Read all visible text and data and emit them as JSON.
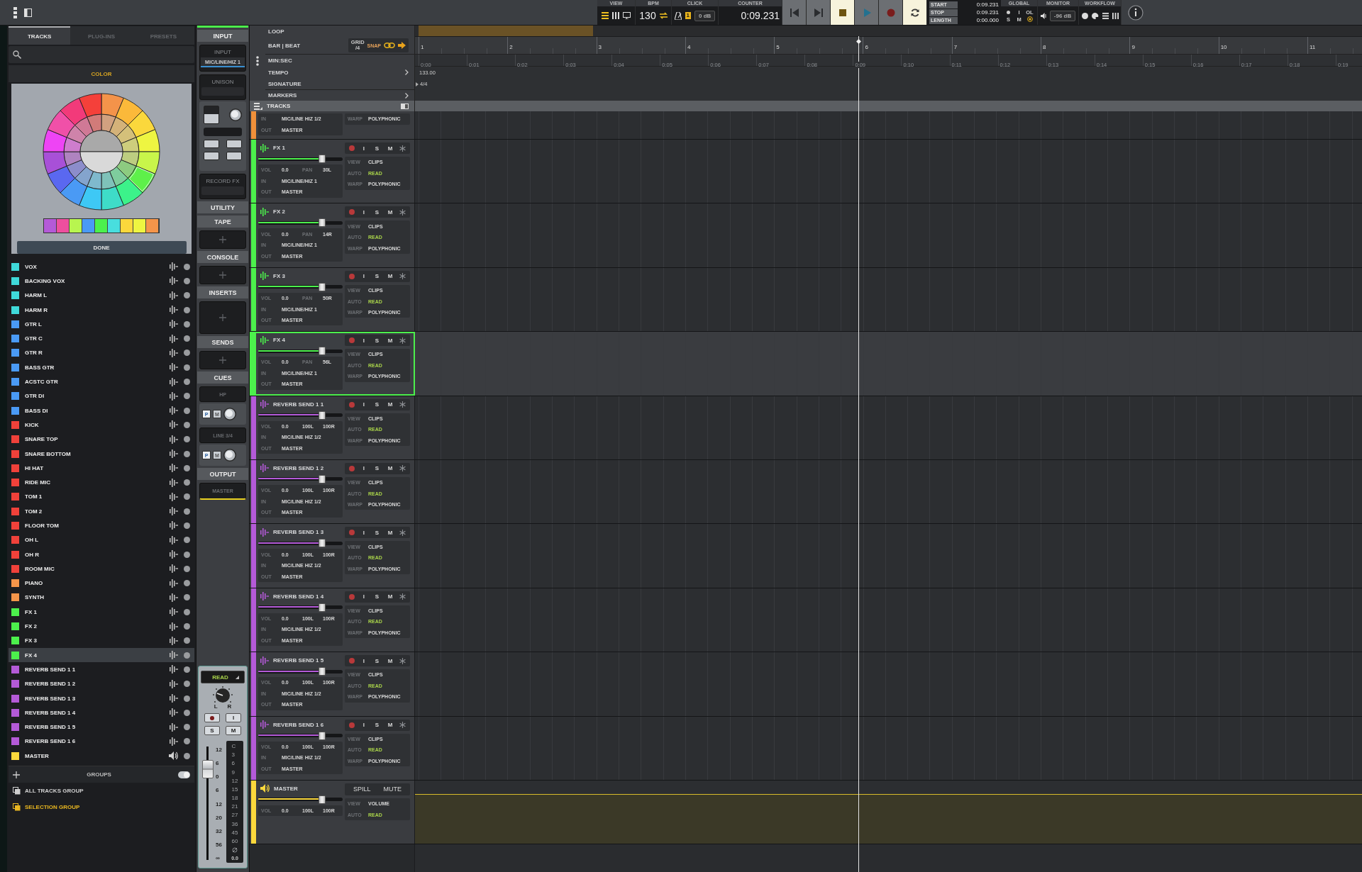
{
  "topbar": {
    "view": {
      "label": "VIEW"
    },
    "bpm": {
      "label": "BPM",
      "value": "130"
    },
    "click": {
      "label": "CLICK",
      "badge": "1",
      "level": "0 dB"
    },
    "counter": {
      "label": "COUNTER",
      "value": "0:09.231"
    },
    "transport": [
      {
        "kind": "prev",
        "on": false
      },
      {
        "kind": "next",
        "on": false
      },
      {
        "kind": "stop",
        "on": true
      },
      {
        "kind": "play",
        "on": false
      },
      {
        "kind": "record",
        "on": false
      },
      {
        "kind": "loop",
        "on": true
      }
    ],
    "positions": [
      {
        "label": "START",
        "value": "0:09.231"
      },
      {
        "label": "STOP",
        "value": "0:09.231"
      },
      {
        "label": "LENGTH",
        "value": "0:00.000"
      }
    ],
    "global": {
      "label": "GLOBAL",
      "items": [
        "I",
        "OL",
        "S",
        "M"
      ]
    },
    "monitor": {
      "label": "MONITOR",
      "value": "-96 dB"
    },
    "workflow": {
      "label": "WORKFLOW"
    }
  },
  "browser": {
    "tabs": [
      {
        "label": "TRACKS",
        "selected": true
      },
      {
        "label": "PLUG-INS",
        "selected": false
      },
      {
        "label": "PRESETS",
        "selected": false
      }
    ],
    "color_header": "COLOR",
    "swatches": [
      {
        "color": "#b45ad8"
      },
      {
        "color": "#ee4f9e"
      },
      {
        "color": "#b8f54f"
      },
      {
        "color": "#4a9af5"
      },
      {
        "color": "#4cf04c"
      },
      {
        "color": "#48dede"
      },
      {
        "color": "#fbd83c"
      },
      {
        "color": "#eef541"
      },
      {
        "color": "#f5954a"
      }
    ],
    "done": "DONE"
  },
  "track_list": [
    {
      "name": "VOX",
      "color": "#3fd9d9",
      "kind": "audio",
      "selected": false
    },
    {
      "name": "BACKING VOX",
      "color": "#3fd9d9",
      "kind": "audio",
      "selected": false
    },
    {
      "name": "HARM L",
      "color": "#3fd9d9",
      "kind": "audio",
      "selected": false
    },
    {
      "name": "HARM R",
      "color": "#3fd9d9",
      "kind": "audio",
      "selected": false
    },
    {
      "name": "GTR L",
      "color": "#4a9af5",
      "kind": "audio",
      "selected": false
    },
    {
      "name": "GTR C",
      "color": "#4a9af5",
      "kind": "audio",
      "selected": false
    },
    {
      "name": "GTR R",
      "color": "#4a9af5",
      "kind": "audio",
      "selected": false
    },
    {
      "name": "BASS GTR",
      "color": "#4a9af5",
      "kind": "audio",
      "selected": false
    },
    {
      "name": "ACSTC GTR",
      "color": "#4a9af5",
      "kind": "audio",
      "selected": false
    },
    {
      "name": "GTR DI",
      "color": "#4a9af5",
      "kind": "audio",
      "selected": false
    },
    {
      "name": "BASS DI",
      "color": "#4a9af5",
      "kind": "audio",
      "selected": false
    },
    {
      "name": "KICK",
      "color": "#f0413a",
      "kind": "audio",
      "selected": false
    },
    {
      "name": "SNARE TOP",
      "color": "#f0413a",
      "kind": "audio",
      "selected": false
    },
    {
      "name": "SNARE BOTTOM",
      "color": "#f0413a",
      "kind": "audio",
      "selected": false
    },
    {
      "name": "HI HAT",
      "color": "#f0413a",
      "kind": "audio",
      "selected": false
    },
    {
      "name": "RIDE MIC",
      "color": "#f0413a",
      "kind": "audio",
      "selected": false
    },
    {
      "name": "TOM 1",
      "color": "#f0413a",
      "kind": "audio",
      "selected": false
    },
    {
      "name": "TOM 2",
      "color": "#f0413a",
      "kind": "audio",
      "selected": false
    },
    {
      "name": "FLOOR TOM",
      "color": "#f0413a",
      "kind": "audio",
      "selected": false
    },
    {
      "name": "OH L",
      "color": "#f0413a",
      "kind": "audio",
      "selected": false
    },
    {
      "name": "OH R",
      "color": "#f0413a",
      "kind": "audio",
      "selected": false
    },
    {
      "name": "ROOM MIC",
      "color": "#f0413a",
      "kind": "audio",
      "selected": false
    },
    {
      "name": "PIANO",
      "color": "#f5954a",
      "kind": "audio",
      "selected": false
    },
    {
      "name": "SYNTH",
      "color": "#f5954a",
      "kind": "audio",
      "selected": false
    },
    {
      "name": "FX 1",
      "color": "#4cf04c",
      "kind": "audio",
      "selected": false
    },
    {
      "name": "FX 2",
      "color": "#4cf04c",
      "kind": "audio",
      "selected": false
    },
    {
      "name": "FX 3",
      "color": "#4cf04c",
      "kind": "audio",
      "selected": false
    },
    {
      "name": "FX 4",
      "color": "#4cf04c",
      "kind": "audio",
      "selected": true
    },
    {
      "name": "REVERB SEND 1 1",
      "color": "#b45ad8",
      "kind": "audio",
      "selected": false
    },
    {
      "name": "REVERB SEND 1 2",
      "color": "#b45ad8",
      "kind": "audio",
      "selected": false
    },
    {
      "name": "REVERB SEND 1 3",
      "color": "#b45ad8",
      "kind": "audio",
      "selected": false
    },
    {
      "name": "REVERB SEND 1 4",
      "color": "#b45ad8",
      "kind": "audio",
      "selected": false
    },
    {
      "name": "REVERB SEND 1 5",
      "color": "#b45ad8",
      "kind": "audio",
      "selected": false
    },
    {
      "name": "REVERB SEND 1 6",
      "color": "#b45ad8",
      "kind": "audio",
      "selected": false
    },
    {
      "name": "MASTER",
      "color": "#fbd83c",
      "kind": "master",
      "selected": false
    }
  ],
  "groups": {
    "title": "GROUPS",
    "on": true,
    "items": [
      {
        "name": "ALL TRACKS GROUP",
        "selected": false
      },
      {
        "name": "SELECTION GROUP",
        "selected": true
      }
    ]
  },
  "channel": {
    "sections": [
      {
        "kind": "header",
        "text": "INPUT"
      },
      {
        "kind": "input",
        "label": "INPUT",
        "value": "MIC/LINE/HIZ 1"
      },
      {
        "kind": "slot",
        "label": "UNISON"
      },
      {
        "kind": "controls"
      },
      {
        "kind": "slot",
        "label": "RECORD FX"
      },
      {
        "kind": "header",
        "text": "UTILITY"
      },
      {
        "kind": "header",
        "text": "TAPE"
      },
      {
        "kind": "add"
      },
      {
        "kind": "header",
        "text": "CONSOLE"
      },
      {
        "kind": "add"
      },
      {
        "kind": "header",
        "text": "INSERTS"
      },
      {
        "kind": "add_large"
      },
      {
        "kind": "header",
        "text": "SENDS"
      },
      {
        "kind": "add"
      },
      {
        "kind": "header",
        "text": "CUES"
      },
      {
        "kind": "cue",
        "label": "HP",
        "buttons": [
          "P",
          "M"
        ]
      },
      {
        "kind": "cue",
        "label": "LINE 3/4",
        "buttons": [
          "P",
          "M"
        ]
      },
      {
        "kind": "header",
        "text": "OUTPUT"
      },
      {
        "kind": "output",
        "value": "MASTER"
      }
    ],
    "strip": {
      "automation": "READ",
      "pan": [
        "L",
        "R"
      ],
      "buttons": [
        "I",
        "S",
        "M"
      ],
      "level": 0.8,
      "fader_scale": [
        "12",
        "6",
        "0",
        "6",
        "12",
        "20",
        "32",
        "56",
        "∞"
      ],
      "meter_scale": [
        "C",
        "3",
        "6",
        "9",
        "12",
        "15",
        "18",
        "21",
        "27",
        "36",
        "45",
        "60"
      ],
      "readout": "0.0"
    }
  },
  "ruler_menu": {
    "rows": [
      {
        "label": "LOOP",
        "kind": "plain"
      },
      {
        "label": "BAR | BEAT",
        "kind": "grid"
      },
      {
        "label": "MIN:SEC",
        "kind": "plain"
      },
      {
        "label": "TEMPO",
        "kind": "submenu"
      },
      {
        "label": "SIGNATURE",
        "kind": "plain"
      },
      {
        "label": "MARKERS",
        "kind": "submenu"
      }
    ],
    "grid": {
      "label": "GRID",
      "value": "/4",
      "snap": "SNAP"
    },
    "tracks_bar": "TRACKS"
  },
  "ruler": {
    "bars": [
      {
        "label": "1",
        "in_loop": true
      },
      {
        "label": "2",
        "in_loop": true
      },
      {
        "label": "3",
        "in_loop": false
      },
      {
        "label": "4",
        "in_loop": false
      },
      {
        "label": "5",
        "in_loop": false
      },
      {
        "label": "6",
        "in_loop": false
      },
      {
        "label": "7",
        "in_loop": false
      },
      {
        "label": "8",
        "in_loop": false
      },
      {
        "label": "9",
        "in_loop": false
      },
      {
        "label": "10",
        "in_loop": false
      },
      {
        "label": "11",
        "in_loop": false
      }
    ],
    "seconds": [
      {
        "label": "0:00",
        "playhead": false
      },
      {
        "label": "0:01",
        "playhead": false
      },
      {
        "label": "0:02",
        "playhead": false
      },
      {
        "label": "0:03",
        "playhead": false
      },
      {
        "label": "0:04",
        "playhead": false
      },
      {
        "label": "0:05",
        "playhead": false
      },
      {
        "label": "0:06",
        "playhead": false
      },
      {
        "label": "0:07",
        "playhead": false
      },
      {
        "label": "0:08",
        "playhead": false
      },
      {
        "label": "0:09",
        "playhead": true
      },
      {
        "label": "0:10",
        "playhead": false
      },
      {
        "label": "0:11",
        "playhead": false
      },
      {
        "label": "0:12",
        "playhead": false
      },
      {
        "label": "0:13",
        "playhead": false
      },
      {
        "label": "0:14",
        "playhead": false
      },
      {
        "label": "0:15",
        "playhead": false
      },
      {
        "label": "0:16",
        "playhead": false
      },
      {
        "label": "0:17",
        "playhead": false
      },
      {
        "label": "0:18",
        "playhead": false
      },
      {
        "label": "0:19",
        "playhead": false
      }
    ],
    "tempo": "133.00",
    "signature": "4/4"
  },
  "tracks": [
    {
      "kind": "partial",
      "color": "#f0903a",
      "selected": false,
      "io": [
        [
          "IN",
          "MIC/LINE HIZ 1/2"
        ],
        [
          "OUT",
          "MASTER"
        ]
      ],
      "info": [
        {
          "label": "WARP",
          "value": "POLYPHONIC"
        }
      ]
    },
    {
      "kind": "audio",
      "name": "FX 1",
      "color": "#4cf04c",
      "selected": false,
      "level": 0.76,
      "vol": [
        "VOL",
        "0.0"
      ],
      "pan_label": "PAN",
      "pan": [
        "30L"
      ],
      "io": [
        [
          "IN",
          "MIC/LINE/HIZ 1"
        ],
        [
          "OUT",
          "MASTER"
        ]
      ],
      "buttons": [
        "I",
        "S",
        "M"
      ],
      "info": [
        {
          "label": "VIEW",
          "value": "CLIPS"
        },
        {
          "label": "AUTO",
          "value": "READ",
          "kind": "auto"
        },
        {
          "label": "WARP",
          "value": "POLYPHONIC"
        }
      ]
    },
    {
      "kind": "audio",
      "name": "FX 2",
      "color": "#4cf04c",
      "selected": false,
      "level": 0.76,
      "vol": [
        "VOL",
        "0.0"
      ],
      "pan_label": "PAN",
      "pan": [
        "14R"
      ],
      "io": [
        [
          "IN",
          "MIC/LINE/HIZ 1"
        ],
        [
          "OUT",
          "MASTER"
        ]
      ],
      "buttons": [
        "I",
        "S",
        "M"
      ],
      "info": [
        {
          "label": "VIEW",
          "value": "CLIPS"
        },
        {
          "label": "AUTO",
          "value": "READ",
          "kind": "auto"
        },
        {
          "label": "WARP",
          "value": "POLYPHONIC"
        }
      ]
    },
    {
      "kind": "audio",
      "name": "FX 3",
      "color": "#4cf04c",
      "selected": false,
      "level": 0.76,
      "vol": [
        "VOL",
        "0.0"
      ],
      "pan_label": "PAN",
      "pan": [
        "50R"
      ],
      "io": [
        [
          "IN",
          "MIC/LINE/HIZ 1"
        ],
        [
          "OUT",
          "MASTER"
        ]
      ],
      "buttons": [
        "I",
        "S",
        "M"
      ],
      "info": [
        {
          "label": "VIEW",
          "value": "CLIPS"
        },
        {
          "label": "AUTO",
          "value": "READ",
          "kind": "auto"
        },
        {
          "label": "WARP",
          "value": "POLYPHONIC"
        }
      ]
    },
    {
      "kind": "audio",
      "name": "FX 4",
      "color": "#4cf04c",
      "selected": true,
      "level": 0.76,
      "vol": [
        "VOL",
        "0.0"
      ],
      "pan_label": "PAN",
      "pan": [
        "56L"
      ],
      "io": [
        [
          "IN",
          "MIC/LINE/HIZ 1"
        ],
        [
          "OUT",
          "MASTER"
        ]
      ],
      "buttons": [
        "I",
        "S",
        "M"
      ],
      "info": [
        {
          "label": "VIEW",
          "value": "CLIPS"
        },
        {
          "label": "AUTO",
          "value": "READ",
          "kind": "auto"
        },
        {
          "label": "WARP",
          "value": "POLYPHONIC"
        }
      ]
    },
    {
      "kind": "audio",
      "name": "REVERB SEND 1 1",
      "color": "#b45ad8",
      "selected": false,
      "level": 0.76,
      "vol": [
        "VOL",
        "0.0"
      ],
      "pan": [
        "100L",
        "100R"
      ],
      "io": [
        [
          "IN",
          "MIC/LINE HIZ 1/2"
        ],
        [
          "OUT",
          "MASTER"
        ]
      ],
      "buttons": [
        "I",
        "S",
        "M"
      ],
      "info": [
        {
          "label": "VIEW",
          "value": "CLIPS"
        },
        {
          "label": "AUTO",
          "value": "READ",
          "kind": "auto"
        },
        {
          "label": "WARP",
          "value": "POLYPHONIC"
        }
      ]
    },
    {
      "kind": "audio",
      "name": "REVERB SEND 1 2",
      "color": "#b45ad8",
      "selected": false,
      "level": 0.76,
      "vol": [
        "VOL",
        "0.0"
      ],
      "pan": [
        "100L",
        "100R"
      ],
      "io": [
        [
          "IN",
          "MIC/LINE HIZ 1/2"
        ],
        [
          "OUT",
          "MASTER"
        ]
      ],
      "buttons": [
        "I",
        "S",
        "M"
      ],
      "info": [
        {
          "label": "VIEW",
          "value": "CLIPS"
        },
        {
          "label": "AUTO",
          "value": "READ",
          "kind": "auto"
        },
        {
          "label": "WARP",
          "value": "POLYPHONIC"
        }
      ]
    },
    {
      "kind": "audio",
      "name": "REVERB SEND 1 3",
      "color": "#b45ad8",
      "selected": false,
      "level": 0.76,
      "vol": [
        "VOL",
        "0.0"
      ],
      "pan": [
        "100L",
        "100R"
      ],
      "io": [
        [
          "IN",
          "MIC/LINE HIZ 1/2"
        ],
        [
          "OUT",
          "MASTER"
        ]
      ],
      "buttons": [
        "I",
        "S",
        "M"
      ],
      "info": [
        {
          "label": "VIEW",
          "value": "CLIPS"
        },
        {
          "label": "AUTO",
          "value": "READ",
          "kind": "auto"
        },
        {
          "label": "WARP",
          "value": "POLYPHONIC"
        }
      ]
    },
    {
      "kind": "audio",
      "name": "REVERB SEND 1 4",
      "color": "#b45ad8",
      "selected": false,
      "level": 0.76,
      "vol": [
        "VOL",
        "0.0"
      ],
      "pan": [
        "100L",
        "100R"
      ],
      "io": [
        [
          "IN",
          "MIC/LINE HIZ 1/2"
        ],
        [
          "OUT",
          "MASTER"
        ]
      ],
      "buttons": [
        "I",
        "S",
        "M"
      ],
      "info": [
        {
          "label": "VIEW",
          "value": "CLIPS"
        },
        {
          "label": "AUTO",
          "value": "READ",
          "kind": "auto"
        },
        {
          "label": "WARP",
          "value": "POLYPHONIC"
        }
      ]
    },
    {
      "kind": "audio",
      "name": "REVERB SEND 1 5",
      "color": "#b45ad8",
      "selected": false,
      "level": 0.76,
      "vol": [
        "VOL",
        "0.0"
      ],
      "pan": [
        "100L",
        "100R"
      ],
      "io": [
        [
          "IN",
          "MIC/LINE HIZ 1/2"
        ],
        [
          "OUT",
          "MASTER"
        ]
      ],
      "buttons": [
        "I",
        "S",
        "M"
      ],
      "info": [
        {
          "label": "VIEW",
          "value": "CLIPS"
        },
        {
          "label": "AUTO",
          "value": "READ",
          "kind": "auto"
        },
        {
          "label": "WARP",
          "value": "POLYPHONIC"
        }
      ]
    },
    {
      "kind": "audio",
      "name": "REVERB SEND 1 6",
      "color": "#b45ad8",
      "selected": false,
      "level": 0.76,
      "vol": [
        "VOL",
        "0.0"
      ],
      "pan": [
        "100L",
        "100R"
      ],
      "io": [
        [
          "IN",
          "MIC/LINE HIZ 1/2"
        ],
        [
          "OUT",
          "MASTER"
        ]
      ],
      "buttons": [
        "I",
        "S",
        "M"
      ],
      "info": [
        {
          "label": "VIEW",
          "value": "CLIPS"
        },
        {
          "label": "AUTO",
          "value": "READ",
          "kind": "auto"
        },
        {
          "label": "WARP",
          "value": "POLYPHONIC"
        }
      ]
    },
    {
      "kind": "master",
      "name": "MASTER",
      "color": "#fbd83c",
      "selected": false,
      "level": 0.76,
      "vol": [
        "VOL",
        "0.0"
      ],
      "pan": [
        "100L",
        "100R"
      ],
      "buttons": [
        "SPILL",
        "MUTE"
      ],
      "info": [
        {
          "label": "VIEW",
          "value": "VOLUME"
        },
        {
          "label": "AUTO",
          "value": "READ",
          "kind": "auto"
        }
      ]
    }
  ]
}
